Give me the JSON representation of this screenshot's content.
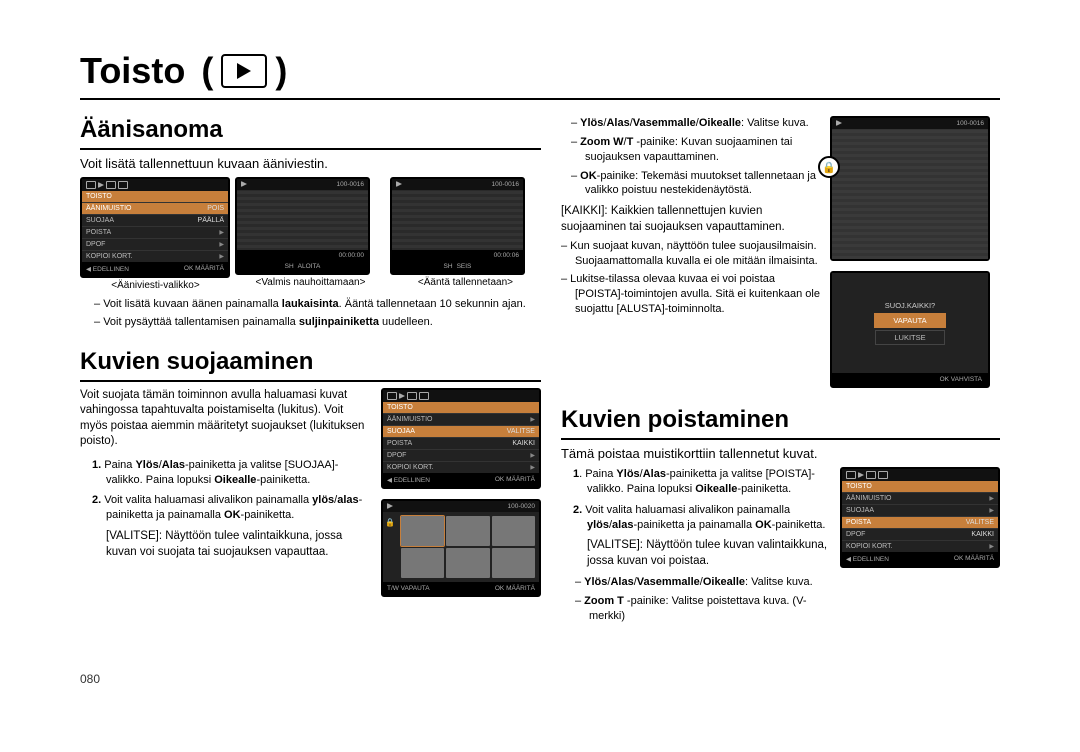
{
  "page_title": "Toisto",
  "page_number": "080",
  "section_voice": {
    "heading": "Äänisanoma",
    "lead": "Voit lisätä tallennettuun kuvaan ääniviestin.",
    "lcd_menu": {
      "title": "TOISTO",
      "rows": [
        {
          "label": "ÄÄNIMUISTIO",
          "value": "POIS"
        },
        {
          "label": "SUOJAA",
          "value": "PÄÄLLÄ"
        },
        {
          "label": "POISTA",
          "value": ""
        },
        {
          "label": "DPOF",
          "value": ""
        },
        {
          "label": "KOPIOI KORT.",
          "value": ""
        }
      ],
      "footer_prev": "◀  EDELLINEN",
      "footer_ok": "OK  MÄÄRITÄ"
    },
    "lcd2": {
      "top_right": "100-0016",
      "timer": "00:00:00",
      "footer_l": "SH",
      "footer_r": "ALOITA"
    },
    "lcd3": {
      "top_right": "100-0016",
      "timer": "00:00:06",
      "footer_l": "SH",
      "footer_r": "SEIS"
    },
    "caption1": "<Ääniviesti-valikko>",
    "caption2": "<Valmis nauhoittamaan>",
    "caption3": "<Ääntä tallennetaan>",
    "notes": [
      "Voit lisätä kuvaan äänen painamalla <b>laukaisinta</b>. Ääntä tallennetaan 10 sekunnin ajan.",
      "Voit pysäyttää tallentamisen painamalla <b>suljinpainiketta</b> uudelleen."
    ]
  },
  "section_protect": {
    "heading": "Kuvien suojaaminen",
    "lead": "Voit suojata tämän toiminnon avulla haluamasi kuvat vahingossa tapahtuvalta poistamiselta (lukitus). Voit myös poistaa aiemmin määritetyt suojaukset (lukituksen poisto).",
    "lcd_menu": {
      "title": "TOISTO",
      "rows": [
        {
          "label": "ÄÄNIMUISTIO",
          "value": ""
        },
        {
          "label": "SUOJAA",
          "value": "VALITSE"
        },
        {
          "label": "POISTA",
          "value": "KAIKKI"
        },
        {
          "label": "DPOF",
          "value": ""
        },
        {
          "label": "KOPIOI KORT.",
          "value": ""
        }
      ],
      "footer_prev": "◀  EDELLINEN",
      "footer_ok": "OK  MÄÄRITÄ"
    },
    "steps": [
      "Paina <b>Ylös</b>/<b>Alas</b>-painiketta ja valitse [SUOJAA]-valikko. Paina lopuksi <b>Oikealle</b>-painiketta.",
      "Voit valita haluamasi alivalikon painamalla <b>ylös</b>/<b>alas</b>-painiketta ja painamalla <b>OK</b>-painiketta."
    ],
    "valitse_label": "[VALITSE]: Näyttöön tulee valintaikkuna, jossa kuvan voi suojata tai suojauksen vapauttaa.",
    "thumb_top": "100-0020",
    "thumb_footer_l": "T/W  VAPAUTA",
    "thumb_footer_r": "OK  MÄÄRITÄ"
  },
  "right_col": {
    "specs": [
      "<b>Ylös</b>/<b>Alas</b>/<b>Vasemmalle</b>/<b>Oikealle</b>: Valitse kuva.",
      "<b>Zoom W</b>/<b>T</b> -painike:  Kuvan suojaaminen tai suojauksen vapauttaminen.",
      "<b>OK</b>-painike:  Tekemäsi muutokset tallennetaan ja valikko poistuu nestekidenäytöstä."
    ],
    "kaikki": "[KAIKKI]: Kaikkien tallennettujen kuvien suojaaminen tai suojauksen vapauttaminen.",
    "bullets": [
      "Kun suojaat kuvan, näyttöön tulee suojausilmaisin. Suojaamattomalla kuvalla ei ole mitään ilmaisinta.",
      "Lukitse-tilassa olevaa kuvaa ei voi poistaa [POISTA]-toimintojen avulla. Sitä ei kuitenkaan ole suojattu [ALUSTA]-toiminnolta."
    ],
    "lock_top": "100-0016",
    "dlg_label": "SUOJ.KAIKKI?",
    "dlg_opt1": "VAPAUTA",
    "dlg_opt2": "LUKITSE",
    "dlg_ok": "OK  VAHVISTA"
  },
  "section_delete": {
    "heading": "Kuvien poistaminen",
    "lead": "Tämä poistaa muistikorttiin tallennetut kuvat.",
    "steps": [
      "Paina <b>Ylös</b>/<b>Alas</b>-painiketta ja valitse [POISTA]-valikko. Paina lopuksi <b>Oikealle</b>-painiketta.",
      "Voit valita haluamasi alivalikon painamalla <b>ylös</b>/<b>alas</b>-painiketta ja painamalla <b>OK</b>-painiketta."
    ],
    "valitse_label": "[VALITSE]: Näyttöön tulee kuvan valintaikkuna, jossa kuvan voi poistaa.",
    "directions": "<b>Ylös</b>/<b>Alas</b>/<b>Vasemmalle</b>/<b>Oikealle</b>: Valitse kuva.",
    "zoom": "<b>Zoom T</b> -painike: Valitse poistettava kuva. (V-merkki)",
    "lcd_menu": {
      "title": "TOISTO",
      "rows": [
        {
          "label": "ÄÄNIMUISTIO",
          "value": ""
        },
        {
          "label": "SUOJAA",
          "value": ""
        },
        {
          "label": "POISTA",
          "value": "VALITSE"
        },
        {
          "label": "DPOF",
          "value": "KAIKKI"
        },
        {
          "label": "KOPIOI KORT.",
          "value": ""
        }
      ],
      "footer_prev": "◀  EDELLINEN",
      "footer_ok": "OK  MÄÄRITÄ"
    }
  }
}
